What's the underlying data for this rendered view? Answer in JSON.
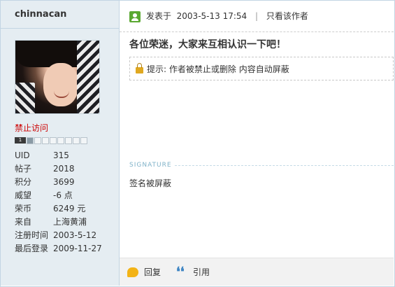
{
  "author": {
    "username": "chinnacan",
    "group": "禁止访问",
    "level_badge": "1",
    "stats": [
      {
        "label": "UID",
        "value": "315"
      },
      {
        "label": "帖子",
        "value": "2018"
      },
      {
        "label": "积分",
        "value": "3699"
      },
      {
        "label": "威望",
        "value": "-6 点"
      },
      {
        "label": "荣币",
        "value": "6249 元"
      },
      {
        "label": "来自",
        "value": "上海黄浦"
      },
      {
        "label": "注册时间",
        "value": "2003-5-12"
      },
      {
        "label": "最后登录",
        "value": "2009-11-27"
      }
    ]
  },
  "post": {
    "posted_label": "发表于",
    "posted_time": "2003-5-13 17:54",
    "separator": "|",
    "author_only_link": "只看该作者",
    "title": "各位荣迷，大家来互相认识一下吧！",
    "notice_prefix": "提示:",
    "notice_text": "作者被禁止或删除 内容自动屏蔽",
    "signature_heading": "SIGNATURE",
    "signature_text": "签名被屏蔽"
  },
  "actions": {
    "reply_label": "回复",
    "quote_label": "引用"
  },
  "colors": {
    "sidebar_bg": "#e5edf2",
    "group_red": "#cc0000",
    "border": "#c2d5e3"
  },
  "icons": [
    "online-icon",
    "lock-icon",
    "reply-icon",
    "quote-icon"
  ]
}
